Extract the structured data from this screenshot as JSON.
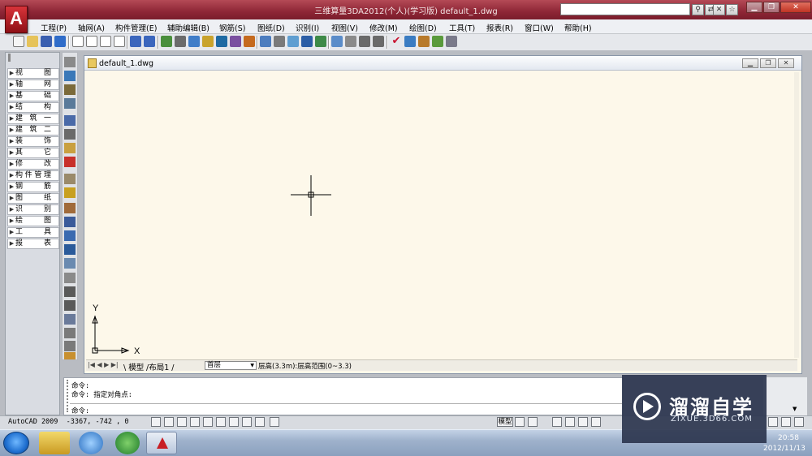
{
  "app": {
    "title": "三维算量3DA2012(个人)(学习版) default_1.dwg",
    "logo_letter": "A"
  },
  "menubar": {
    "items": [
      "工程(P)",
      "轴网(A)",
      "构件管理(E)",
      "辅助编辑(B)",
      "钢筋(S)",
      "图纸(D)",
      "识别(I)",
      "视图(V)",
      "修改(M)",
      "绘图(D)",
      "工具(T)",
      "报表(R)",
      "窗口(W)",
      "帮助(H)"
    ]
  },
  "side_panel": {
    "items": [
      "视图",
      "轴网",
      "基础",
      "结构",
      "建筑一",
      "建筑二",
      "装饰",
      "其它",
      "修改",
      "构件管理",
      "钢筋",
      "图纸",
      "识别",
      "绘图",
      "工具",
      "报表"
    ]
  },
  "drawing": {
    "title": "default_1.dwg",
    "ucs_x": "X",
    "ucs_y": "Y",
    "tab_model": "模型",
    "tab_layout": "布局1",
    "layer_value": "首层",
    "layer_info": "层高(3.3m):层高范围(0~3.3)"
  },
  "command": {
    "line1": "命令:",
    "line2": "命令: 指定对角点:",
    "line3": "命令:"
  },
  "status": {
    "product": "AutoCAD 2009",
    "coords": "-3367, -742 , 0",
    "model_label": "模型"
  },
  "taskbar": {
    "time": "20:58",
    "date": "2012/11/13"
  },
  "watermark": {
    "title": "溜溜自学",
    "subtitle": "ZIXUE.3D66.COM"
  },
  "colors": {
    "titlebar": "#8e2636",
    "canvas": "#fdf8ea",
    "taskbar": "#9fb2cc"
  }
}
